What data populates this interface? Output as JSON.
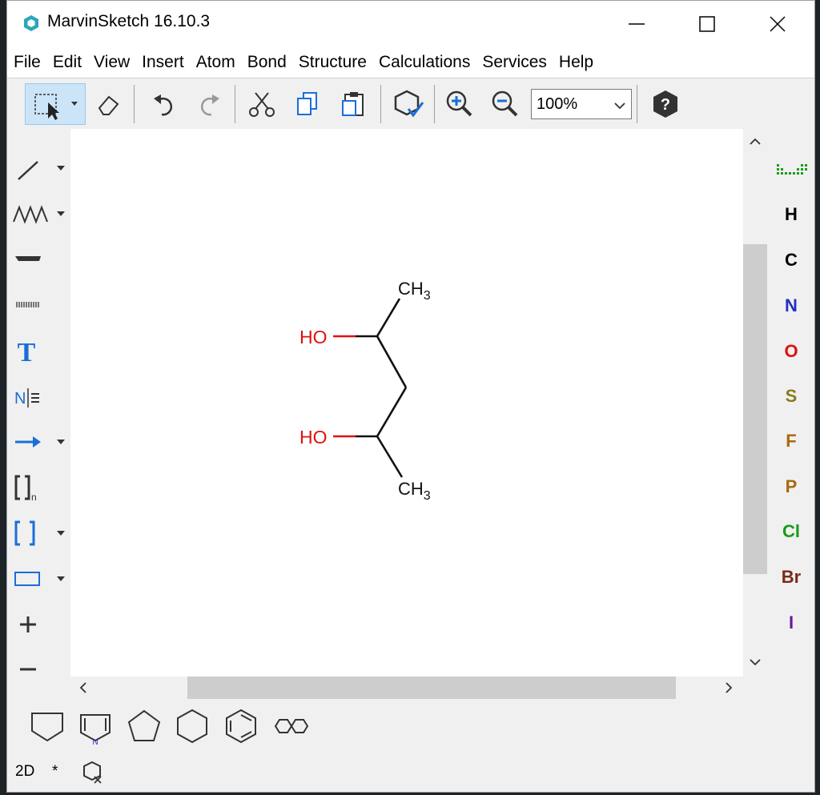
{
  "window": {
    "title": "MarvinSketch 16.10.3"
  },
  "menu": [
    "File",
    "Edit",
    "View",
    "Insert",
    "Atom",
    "Bond",
    "Structure",
    "Calculations",
    "Services",
    "Help"
  ],
  "toolbar": {
    "zoom_value": "100%"
  },
  "molecule": {
    "labels": {
      "ch3_top": "CH",
      "ch3_top_sub": "3",
      "ho_top": "HO",
      "ho_bottom": "HO",
      "ch3_bottom": "CH",
      "ch3_bottom_sub": "3"
    }
  },
  "left_tools": {
    "bracket_n_sub": "n"
  },
  "elements": [
    {
      "symbol": "H",
      "color": "#000000"
    },
    {
      "symbol": "C",
      "color": "#000000"
    },
    {
      "symbol": "N",
      "color": "#2030c0"
    },
    {
      "symbol": "O",
      "color": "#e01010"
    },
    {
      "symbol": "S",
      "color": "#8a7a1a"
    },
    {
      "symbol": "F",
      "color": "#a86a10"
    },
    {
      "symbol": "P",
      "color": "#a86a10"
    },
    {
      "symbol": "Cl",
      "color": "#1a9a1a"
    },
    {
      "symbol": "Br",
      "color": "#7a2a1a"
    },
    {
      "symbol": "I",
      "color": "#6a1a9a"
    }
  ],
  "status": {
    "mode": "2D",
    "star": "*"
  },
  "colors": {
    "accent": "#1a6ed8",
    "atom_oxygen": "#e01010"
  }
}
